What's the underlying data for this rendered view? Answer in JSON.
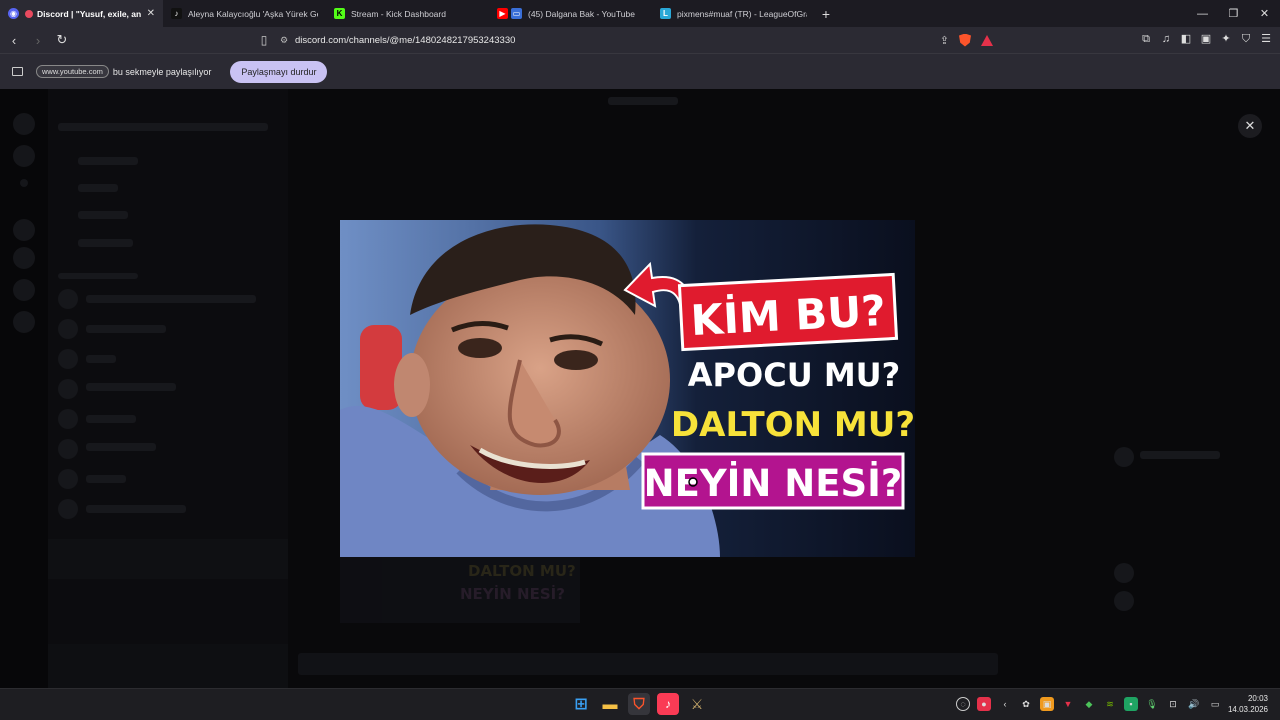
{
  "browser": {
    "tabs": [
      {
        "title": "Discord | \"Yusuf, exile, andis",
        "favicon_color": "#5865f2",
        "active": true
      },
      {
        "title": "Aleyna Kalaycıoğlu 'Aşka Yürek Gerek",
        "favicon_color": "#000000",
        "active": false
      },
      {
        "title": "Stream - Kick Dashboard",
        "favicon_color": "#53fc18",
        "active": false
      },
      {
        "title": "(45) Dalgana Bak - YouTube",
        "favicon_color": "#ff0000",
        "active": false
      },
      {
        "title": "pixmens#muaf (TR) - LeagueOfGraph",
        "favicon_color": "#2aa8d8",
        "active": false
      }
    ],
    "new_tab_glyph": "+",
    "url": "discord.com/channels/@me/1480248217953243330"
  },
  "share_bar": {
    "chip": "www.youtube.com",
    "text": "bu sekmeyle paylaşılıyor",
    "stop_button": "Paylaşmayı durdur"
  },
  "viewer": {
    "image_alt": "KİM BU? APOCU MU? DALTON MU? NEYİN NESİ?",
    "lines": [
      "KİM BU?",
      "APOCU MU?",
      "DALTON MU?",
      "NEYİN NESİ?"
    ],
    "ghost_lines": [
      "DALTON MU?",
      "NEYİN NESİ?"
    ]
  },
  "taskbar": {
    "time": "20:03",
    "date": "14.03.2026"
  },
  "colors": {
    "accent_stop": "#c9c2f3",
    "red_banner": "#e01b2e",
    "purple_banner": "#b3148f",
    "yellow_text": "#f7e23a"
  }
}
